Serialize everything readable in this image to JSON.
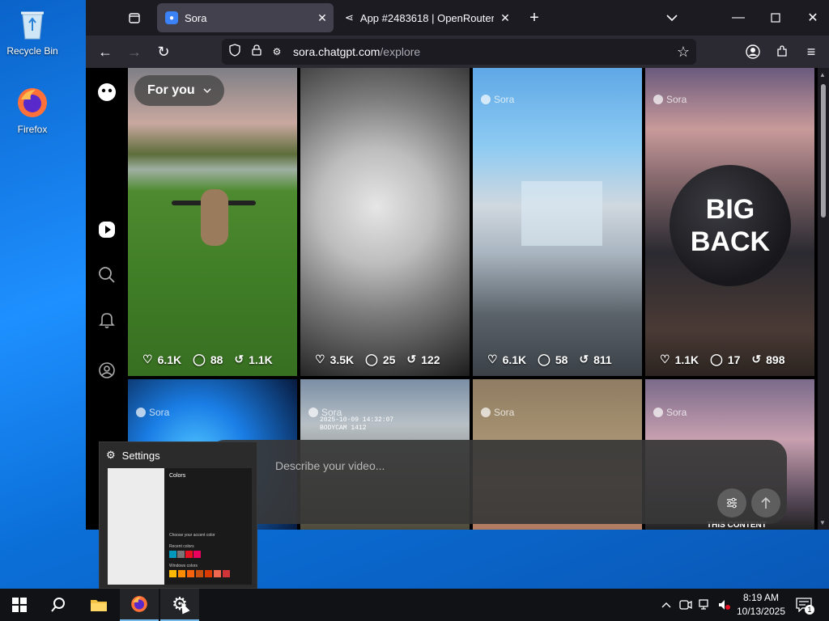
{
  "desktop": {
    "icons": [
      {
        "label": "Recycle Bin",
        "icon": "recycle-bin-icon"
      },
      {
        "label": "Firefox",
        "icon": "firefox-icon"
      }
    ]
  },
  "browser": {
    "tabs": [
      {
        "title": "Sora",
        "active": true
      },
      {
        "title": "App #2483618 | OpenRouter",
        "active": false
      }
    ],
    "url": {
      "host": "sora.chatgpt.com",
      "path": "/explore"
    }
  },
  "sora": {
    "feed_filter": "For you",
    "watermark": "Sora",
    "tiles": [
      {
        "likes": "6.1K",
        "comments": "88",
        "remixes": "1.1K"
      },
      {
        "likes": "3.5K",
        "comments": "25",
        "remixes": "122"
      },
      {
        "likes": "6.1K",
        "comments": "58",
        "remixes": "811"
      },
      {
        "likes": "1.1K",
        "comments": "17",
        "remixes": "898"
      }
    ],
    "big_back_text": [
      "BIG",
      "BACK"
    ],
    "bodycam_stamp": [
      "2025-10-09 14:32:07",
      "BODYCAM 1412"
    ],
    "tile8_caption": "THIS CONTENT",
    "prompt_placeholder": "Describe your video..."
  },
  "preview": {
    "title": "Settings",
    "colors_heading": "Colors",
    "choose_accent": "Choose your accent color",
    "windows_colors": "Windows colors",
    "recent_colors": "Recent colors",
    "accent_swatches": [
      "#0099bc",
      "#7a7574",
      "#e81123",
      "#ea005e"
    ],
    "window_swatches": [
      "#ffb900",
      "#ff8c00",
      "#f7630c",
      "#ca5010",
      "#da3b01",
      "#ef6950",
      "#d13438"
    ]
  },
  "taskbar": {
    "time": "8:19 AM",
    "date": "10/13/2025",
    "notification_count": "1"
  }
}
